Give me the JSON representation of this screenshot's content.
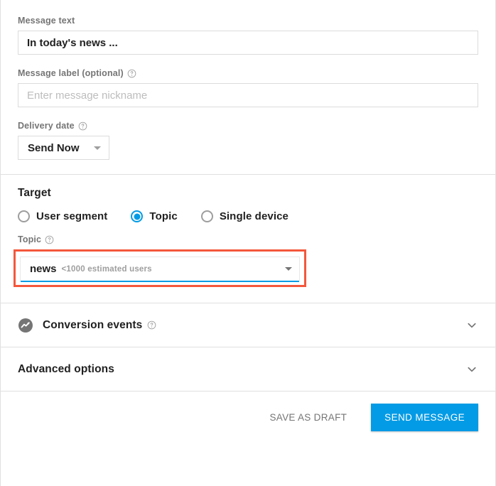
{
  "message": {
    "text_label": "Message text",
    "text_value": "In today's news ...",
    "nickname_label": "Message label (optional)",
    "nickname_placeholder": "Enter message nickname",
    "delivery_label": "Delivery date",
    "delivery_value": "Send Now"
  },
  "target": {
    "title": "Target",
    "options": [
      {
        "label": "User segment",
        "selected": false
      },
      {
        "label": "Topic",
        "selected": true
      },
      {
        "label": "Single device",
        "selected": false
      }
    ],
    "topic_label": "Topic",
    "topic_value": "news",
    "topic_estimate": "<1000 estimated users"
  },
  "sections": {
    "conversion_events": "Conversion events",
    "advanced_options": "Advanced options"
  },
  "footer": {
    "save_draft": "SAVE AS DRAFT",
    "send_message": "SEND MESSAGE"
  },
  "icons": {
    "help": "help-circle-icon",
    "chevron": "chevron-down-icon",
    "conversion": "analytics-trend-icon",
    "caret": "caret-down-icon"
  },
  "colors": {
    "accent": "#039be5",
    "highlight": "#f4573b",
    "label": "#757575",
    "border": "#e0e0e0"
  }
}
